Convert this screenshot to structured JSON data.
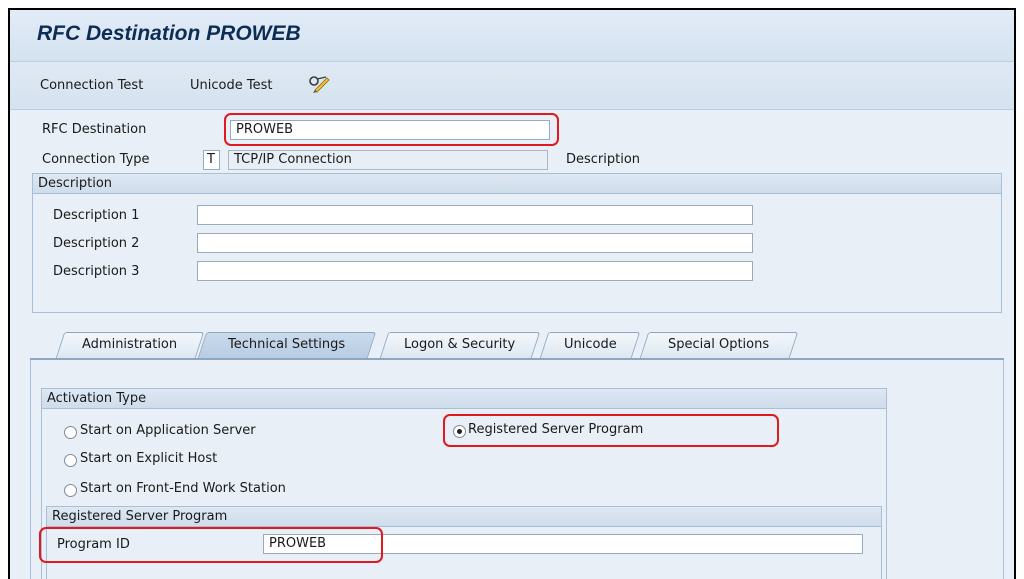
{
  "header": {
    "title": "RFC Destination PROWEB"
  },
  "toolbar": {
    "connection_test": "Connection Test",
    "unicode_test": "Unicode Test",
    "glasses_icon": "display-change-icon"
  },
  "form": {
    "rfc_destination_label": "RFC Destination",
    "rfc_destination_value": "PROWEB",
    "connection_type_label": "Connection Type",
    "connection_type_code": "T",
    "connection_type_text": "TCP/IP Connection",
    "description_label": "Description"
  },
  "description_group": {
    "title": "Description",
    "fields": [
      {
        "label": "Description 1",
        "value": ""
      },
      {
        "label": "Description 2",
        "value": ""
      },
      {
        "label": "Description 3",
        "value": ""
      }
    ]
  },
  "tabs": [
    {
      "label": "Administration",
      "active": false
    },
    {
      "label": "Technical Settings",
      "active": true
    },
    {
      "label": "Logon & Security",
      "active": false
    },
    {
      "label": "Unicode",
      "active": false
    },
    {
      "label": "Special Options",
      "active": false
    }
  ],
  "activation": {
    "title": "Activation Type",
    "options": [
      {
        "label": "Start on Application Server",
        "selected": false
      },
      {
        "label": "Start on Explicit Host",
        "selected": false
      },
      {
        "label": "Start on Front-End Work Station",
        "selected": false
      },
      {
        "label": "Registered Server Program",
        "selected": true
      }
    ]
  },
  "registered_server": {
    "title": "Registered Server Program",
    "program_id_label": "Program ID",
    "program_id_value": "PROWEB"
  },
  "colors": {
    "highlight": "#e0191e",
    "title_text": "#0d2d55",
    "panel_bg": "#e8eff6"
  }
}
